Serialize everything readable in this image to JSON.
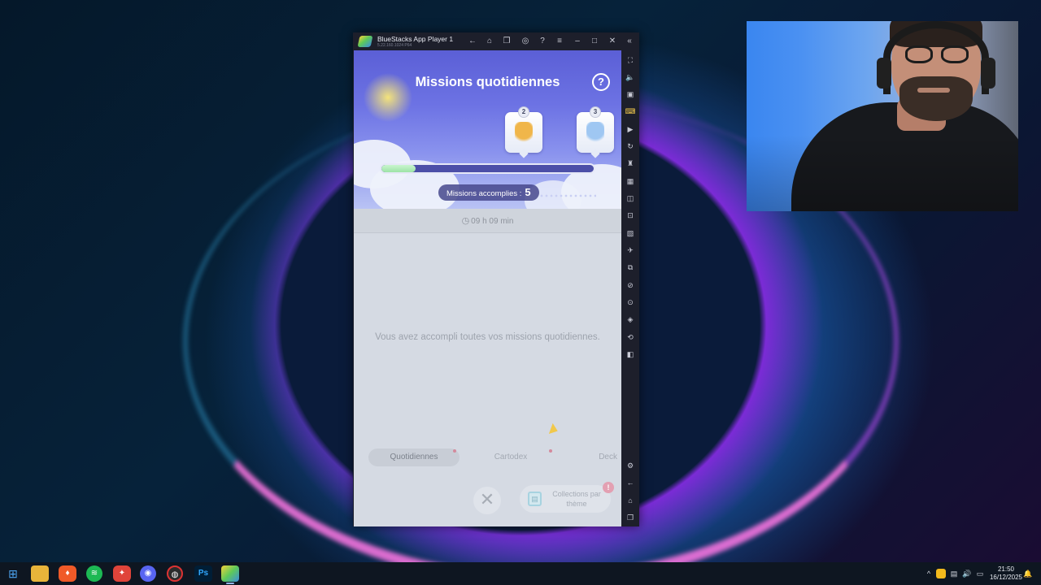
{
  "emulator": {
    "title": "BlueStacks App Player 1",
    "subtitle": "5.22.160.1024 P64"
  },
  "game": {
    "title": "Missions quotidiennes",
    "help_glyph": "?",
    "rewards": [
      {
        "tier": "2",
        "art_color": "#f0b64a"
      },
      {
        "tier": "3",
        "art_color": "#9fc7f2"
      }
    ],
    "progress_fraction": 0.16,
    "missions_label": "Missions accomplies :",
    "missions_count": "5",
    "timer": "09 h 09 min",
    "done_message": "Vous avez accompli toutes vos missions quotidiennes.",
    "tabs": [
      {
        "label": "Quotidiennes",
        "active": true
      },
      {
        "label": "Cartodex",
        "active": false
      },
      {
        "label": "Deck",
        "active": false
      }
    ],
    "close_glyph": "✕",
    "collections_label": "Collections par thème",
    "notification": "!"
  },
  "taskbar": {
    "time": "21:50",
    "date": "16/12/2025",
    "ps_label": "Ps"
  },
  "colors": {
    "hero_top": "#5b5fd6",
    "progress_fill": "#9de3a6",
    "accent_cursor": "#f1c84b"
  }
}
